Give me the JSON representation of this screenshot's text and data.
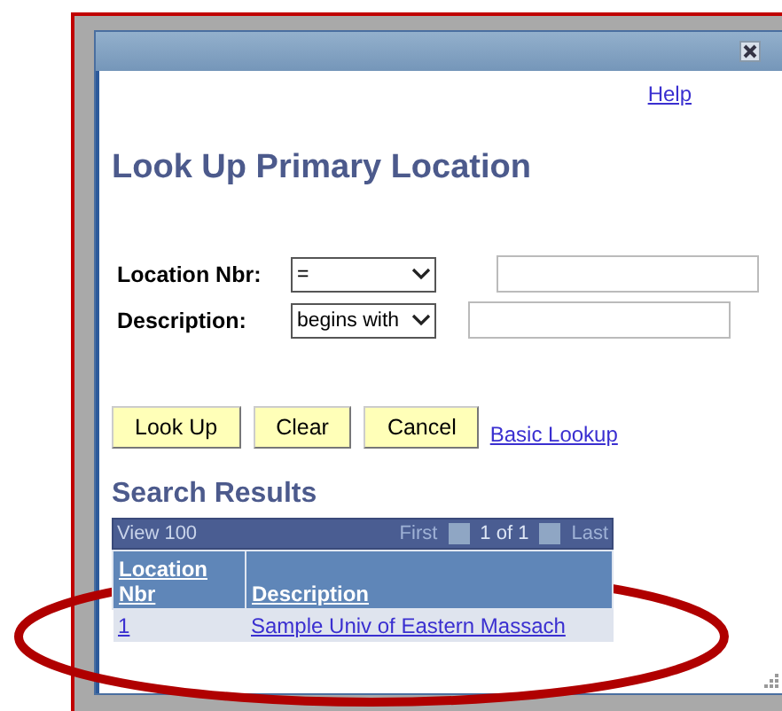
{
  "dialog": {
    "help_link": "Help",
    "title": "Look Up Primary Location",
    "criteria": [
      {
        "label": "Location Nbr:",
        "operator": "="
      },
      {
        "label": "Description:",
        "operator": "begins with"
      }
    ],
    "buttons": [
      "Look Up",
      "Clear",
      "Cancel"
    ],
    "basic_lookup_link": "Basic Lookup",
    "results": {
      "heading": "Search Results",
      "view_all": "View 100",
      "first": "First",
      "page": "1 of 1",
      "last": "Last",
      "columns": [
        "Location Nbr",
        "Description"
      ],
      "rows": [
        [
          "1",
          "Sample Univ of Eastern Massach"
        ]
      ]
    }
  }
}
